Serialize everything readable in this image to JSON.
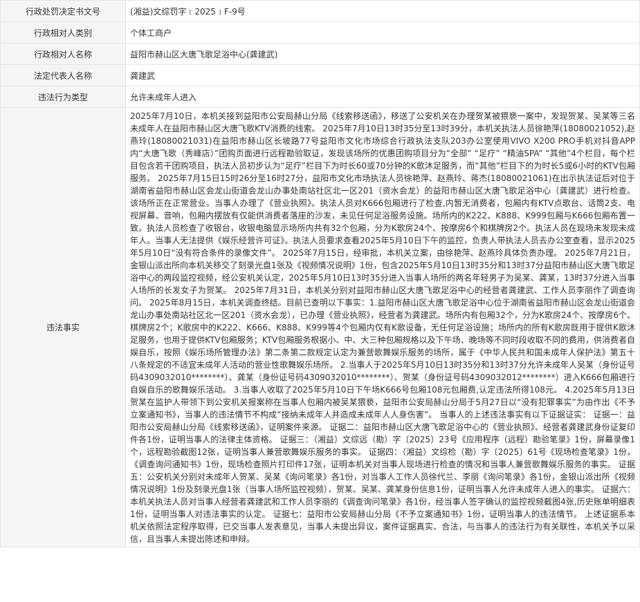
{
  "rows": [
    {
      "label": "行政处罚决定书文号",
      "value": "(湘益)文综罚字﹝2025﹞F-9号"
    },
    {
      "label": "行政相对人类别",
      "value": "个体工商户"
    },
    {
      "label": "行政相对人名称",
      "value": "益阳市赫山区大唐飞歌足浴中心(龚建武)"
    },
    {
      "label": "法定代表人名称",
      "value": "龚建武"
    },
    {
      "label": "违法行为类型",
      "value": "允许未成年人进入"
    }
  ],
  "facts": {
    "label": "违法事实",
    "text": "2025年7月10日，本机关接到益阳市公安局赫山分局《线索移送函》，移送了公安机关在办理贺某被猥亵一案中，发现贺某、吴某等三名未成年人在益阳市赫山区大唐飞歌KTV消费的线索。 2025年7月10日13时35分至13时39分，本机关执法人员徐艳萍(18080021052),赵燕玲(18080021031)在益阳市赫山区长坡路77号益阳市文化市场综合行政执法支队203办公室使用VIVO X200 PRO手机对抖音APP内“大唐飞歌（秀峰店）”团购页面进行远程勘验取证，发现该场所的优惠团购项目分为“全部”  “足疗”  “精油SPA”  “其他”4个栏目，每个栏目包含若干团购项目，执法人员初步认为“足疗”栏目下为时长60或70分钟的K歌沐足服务，而“其他”栏目下的为时长5或6小时的KTV包厢服务。 2025年7月15日15时26分至16时27分，益阳市文化市场执法人员徐艳萍、赵燕玲、蒋杰(18080021061)在出示执法证后对位于湖南省益阳市赫山区会龙山街道会龙山办事处南站社区北一区201（资水会龙）的益阳市赫山区大唐飞歌足浴中心（龚建武）进行检查。该场所正在正常营业。当事人办理了《营业执照》。执法人员对K666包厢进行了检查,内暂无消费者，包厢内有KTV点歌台、话筒2支、电视屏幕、音响，包厢内摆放有仅能供消费者落座的沙发，未见任何足浴服务设施。场所内的K222、K888、K999包厢与K666包厢布置一致。执法人员检查了收银台，收银电脑显示场所内共有32个包厢，分为K歌房24个、按摩房6个和棋牌房2个。执法人员在现场未发现未成年人。当事人无法提供《娱乐经营许可证》。执法人员要求查看2025年5月10日下午的监控，负责人带执法人员去办公室查看，显示2025年5月10日“没有符合条件的录像文件”。 2025年7月15日，经审批，本机关立案，由徐艳萍、赵燕玲具体负责办理。 2025年7月21日，金银山派出所向本机关移交了刻录光盘1张及《视频情况说明》1份，包含2025年5月10日13时35分和13时37分益阳市赫山区大唐飞歌足浴中心的两段监控视频，经公安机关认定，2025年5月10日13时35分进入当事人场所的两名年轻男子为吴某、龚某，13时37分进入当事人场所的长发女子为贺某。 2025年7月31日，本机关分别对益阳市赫山区大唐飞歌足浴中心的经营者龚建武、工作人员李丽作了调查询问。 2025年8月15日，本机关调查终结。目前已查明以下事实：1.益阳市赫山区大唐飞歌足浴中心位于湖南省益阳市赫山区会龙山街道会龙山办事处南站社区北一区201（资水会龙），已办理《营业执照》，经营者为龚建武。场所内有包厢32个，分为K歌房24个、按摩房6个、棋牌房2个；K歌房中的K222、K666、K888、K999等4个包厢内仅有K歌设备，无任何足浴设施；场所内的所有K歌房既用于提供K歌沐足服务，也用于提供KTV包厢服务；KTV包厢服务根据小、中、大三种包厢规格以及下午场、晚场等不同时段收取不同的费用，供消费者自娱自乐，按照《娱乐场所管理办法》第二条第二款规定认定为兼营歌舞娱乐服务的场所，属于《中华人民共和国未成年人保护法》第五十八条规定的不适宜未成年人活动的营业性歌舞娱乐场所。 2.当事人于2025年5月10日13时35分和13时37分允许未成年人吴某（身份证号码4309032010********）、龚某（身份证号码4309032010********）、贺某（身份证号码4309032012********）进入K666包厢进行自娱自乐的歌舞娱乐活动。 3.当事人收取了2025年5月10日下午场K666号包厢108元包厢费,认定违法所得108元。 4.2025年5月13日贺某在监护人带领下到公安机关报案称在当事人包厢内被吴某猥亵，益阳市公安局赫山分局于5月27日以“没有犯罪事实”为由作出《不予立案通知书》，当事人的违法情节不构成“接纳未成年人并造成未成年人人身伤害”。 当事人的上述违法事实有以下证据证实： 证据一：益阳市公安局赫山分局《线索移送函》，证明案件来源。 证据二：益阳市赫山区大唐飞歌足浴中心的《营业执照》、经营者龚建武身份证复印件各1份，证明当事人的法律主体资格。 证据三：（湘益）文综远（勘）字〔2025〕23号《应用程序（远程）勘验笔录》1份，屏幕录像1个，远程勘验截图12张，证明当事人兼营歌舞娱乐服务的事实。 证据四：（湘益）文综检（勘）字〔2025〕61号《现场检查笔录》1份，《调查询问通知书》1份，现场检查照片打印件17张，证明本机关对当事人现场进行检查的情况和当事人兼营歌舞娱乐服务的事实。 证据五：公安机关分别对未成年人贺某、吴某《询问笔录》各1份，对当事人工作人员徐代兰、李丽《询问笔录》各1份，金银山派出所《视频情况说明》1份及刻录光盘1张（当事人场所监控视频），贺某、吴某、龚某身份信息1份，证明当事人允许未成年人进入的事实。 证据六：本机关执法人员对当事人经营者龚建武和工作人员李丽的《调查询问笔录》各1份，经当事人签字确认的监控视频截图4张,历史账单明细表1份，证明当事人对违法事实的认定。 证据七：益阳市公安局赫山分局《不予立案通知书》1份，证明当事人的违法情节。 上述证据系本机关依照法定程序取得，已交当事人发表意见，当事人未提出异议，案件证据真实、合法，与当事人的违法行为有关联性，本机关予以采信，且当事人未提出陈述和申辩。"
  }
}
